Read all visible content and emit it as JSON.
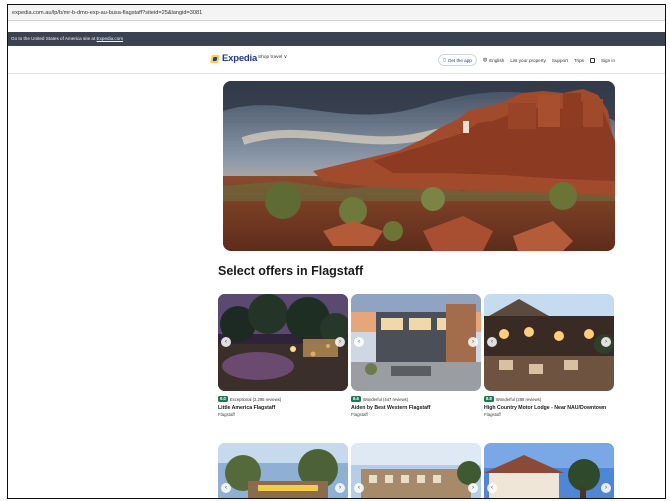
{
  "browser": {
    "url": "expedia.com.au/lp/b/mr-b-dmo-exp-au-busa-flagstaff?siteid=25&langid=3081"
  },
  "notice": {
    "text": "Go to the United States of America site at",
    "link": "Expedia.com"
  },
  "nav": {
    "brand": "Expedia",
    "shop_travel": "Shop travel ∨",
    "get_app": "Get the app",
    "language": "English",
    "list_property": "List your property",
    "support": "Support",
    "trips": "Trips",
    "sign_in": "Sign in"
  },
  "main": {
    "section_title": "Select offers in Flagstaff",
    "cards": [
      {
        "score": "9.0",
        "rating_text": "Exceptional (2,295 reviews)",
        "name": "Little America Flagstaff",
        "location": "Flagstaff"
      },
      {
        "score": "8.6",
        "rating_text": "Wonderful (447 reviews)",
        "name": "Aiden by Best Western Flagstaff",
        "location": "Flagstaff"
      },
      {
        "score": "8.8",
        "rating_text": "Wonderful (288 reviews)",
        "name": "High Country Motor Lodge - Near NAU/Downtown",
        "location": "Flagstaff"
      }
    ]
  },
  "colors": {
    "brand_blue": "#1f3a93",
    "brand_yellow": "#ffd23f",
    "rating_green": "#227950",
    "notice_bg": "#3b4252"
  }
}
